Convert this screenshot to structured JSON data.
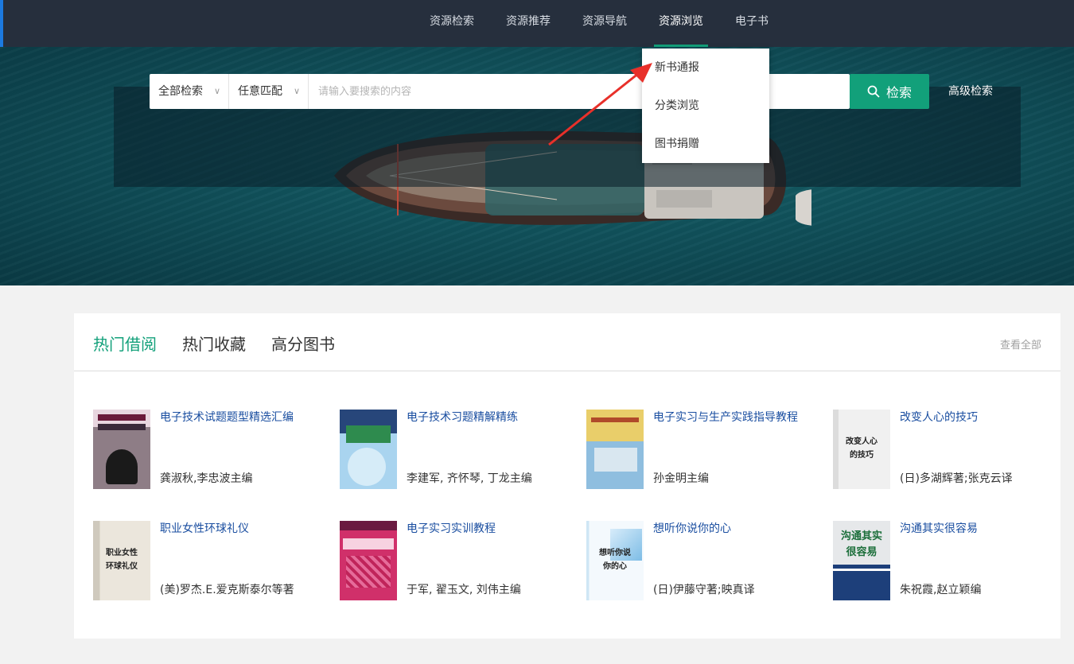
{
  "nav": {
    "items": [
      {
        "label": "资源检索"
      },
      {
        "label": "资源推荐"
      },
      {
        "label": "资源导航"
      },
      {
        "label": "资源浏览",
        "active": true
      },
      {
        "label": "电子书"
      }
    ]
  },
  "dropdown": {
    "items": [
      {
        "label": "新书通报"
      },
      {
        "label": "分类浏览"
      },
      {
        "label": "图书捐赠"
      }
    ]
  },
  "search": {
    "scope_select": "全部检索",
    "match_select": "任意匹配",
    "placeholder": "请输入要搜索的内容",
    "button_label": "检索",
    "advanced_label": "高级检索"
  },
  "books_section": {
    "tabs": [
      {
        "label": "热门借阅",
        "active": true
      },
      {
        "label": "热门收藏"
      },
      {
        "label": "高分图书"
      }
    ],
    "view_all_label": "查看全部",
    "books": [
      {
        "title": "电子技术试题题型精选汇编",
        "author": "龚淑秋,李忠波主编",
        "cover_text": ""
      },
      {
        "title": "电子技术习题精解精练",
        "author": "李建军, 齐怀琴, 丁龙主编",
        "cover_text": ""
      },
      {
        "title": "电子实习与生产实践指导教程",
        "author": "孙金明主编",
        "cover_text": ""
      },
      {
        "title": "改变人心的技巧",
        "author": "(日)多湖辉著;张克云译",
        "cover_text": "改变人心\n的技巧"
      },
      {
        "title": "职业女性环球礼仪",
        "author": "(美)罗杰.E.爱克斯泰尔等著",
        "cover_text": "职业女性\n环球礼仪"
      },
      {
        "title": "电子实习实训教程",
        "author": "于军, 翟玉文, 刘伟主编",
        "cover_text": ""
      },
      {
        "title": "想听你说你的心",
        "author": "(日)伊藤守著;映真译",
        "cover_text": "想听你说\n你的心"
      },
      {
        "title": "沟通其实很容易",
        "author": "朱祝霞,赵立颖编",
        "cover_text": "沟通其实\n很容易"
      }
    ]
  },
  "colors": {
    "nav_bg": "#262f3d",
    "accent": "#12a07a",
    "link": "#1a4ea0"
  }
}
